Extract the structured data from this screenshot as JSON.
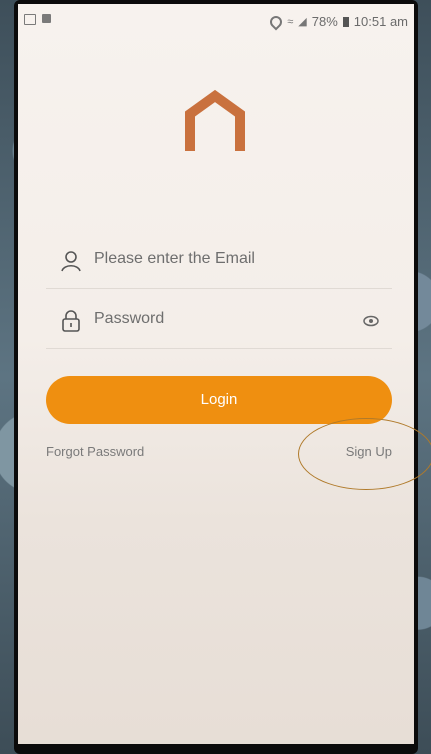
{
  "status_bar": {
    "battery": "78%",
    "time": "10:51 am"
  },
  "login_form": {
    "email_placeholder": "Please enter the Email",
    "password_placeholder": "Password",
    "login_label": "Login",
    "forgot_label": "Forgot Password",
    "signup_label": "Sign Up"
  },
  "colors": {
    "accent": "#ef8f10",
    "logo": "#c9713e",
    "annotation": "#b07a2a"
  },
  "icons": [
    "gallery-icon",
    "video-icon",
    "location-icon",
    "wifi-icon",
    "signal-icon",
    "battery-icon",
    "app-logo-icon",
    "user-icon",
    "lock-icon",
    "eye-icon"
  ]
}
